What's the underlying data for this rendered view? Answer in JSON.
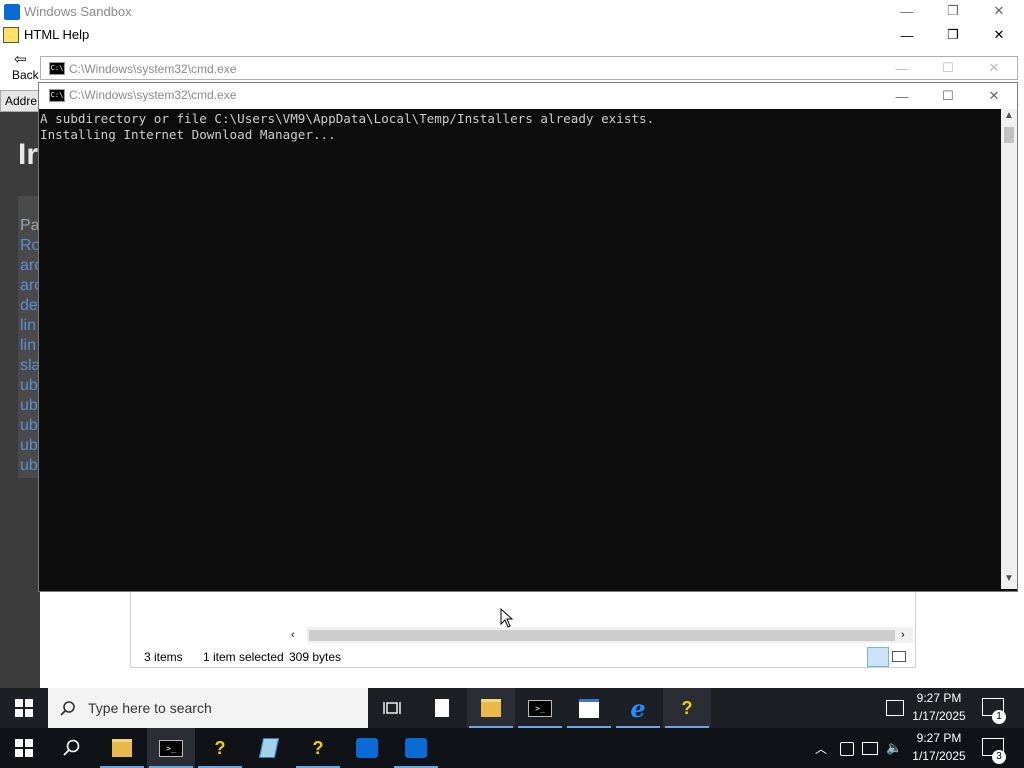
{
  "sandbox": {
    "title": "Windows Sandbox",
    "controls": {
      "minimize": "—",
      "restore": "❐",
      "close": "✕"
    }
  },
  "help": {
    "title": "HTML Help",
    "back_label": "Back",
    "address_label": "Addre",
    "heading": "Ir",
    "links": [
      "Pa",
      "Ro",
      "arc",
      "arc",
      "de",
      "lin",
      "lin",
      "sla",
      "ub",
      "ub",
      "ub",
      "ub",
      "ub"
    ]
  },
  "explorer": {
    "items_count": "3 items",
    "selection": "1 item selected",
    "size": "309 bytes"
  },
  "cmd_behind": {
    "title": "C:\\Windows\\system32\\cmd.exe"
  },
  "cmd": {
    "title": "C:\\Windows\\system32\\cmd.exe",
    "lines": [
      "A subdirectory or file C:\\Users\\VM9\\AppData\\Local\\Temp/Installers already exists.",
      "Installing Internet Download Manager..."
    ]
  },
  "taskbar_inner": {
    "search_placeholder": "Type here to search",
    "time": "9:27 PM",
    "date": "1/17/2025",
    "notifications": "1"
  },
  "taskbar_outer": {
    "time": "9:27 PM",
    "date": "1/17/2025",
    "notifications": "3"
  },
  "colors": {
    "taskbar": "#0f1216",
    "accent": "#0078d7",
    "cmd_bg": "#0c0c0c",
    "cmd_text": "#cccccc"
  }
}
